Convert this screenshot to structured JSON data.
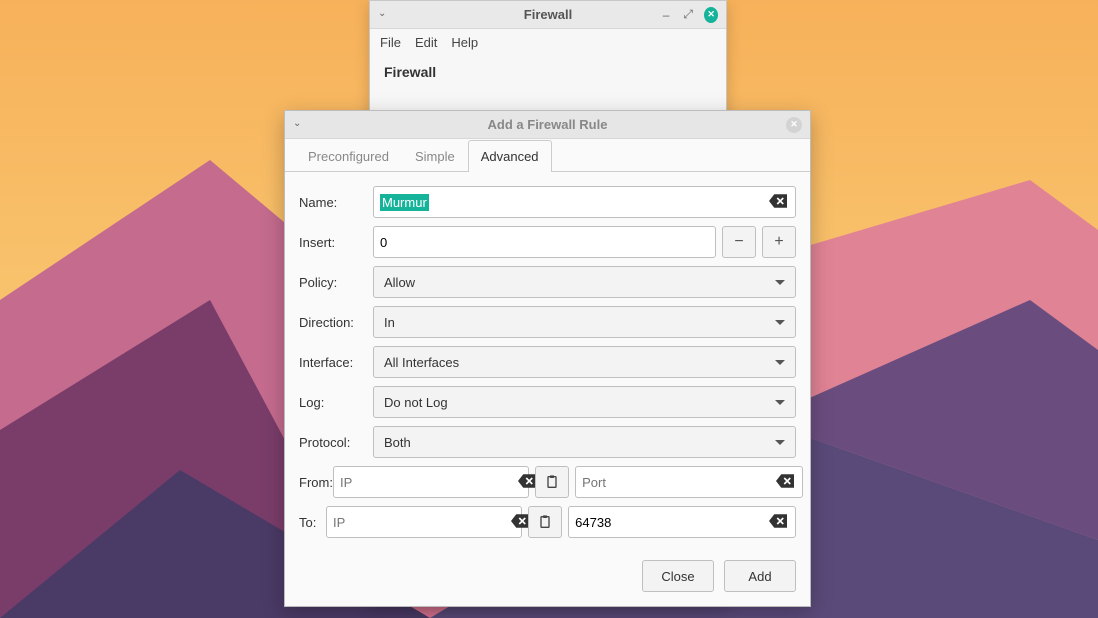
{
  "main_window": {
    "title": "Firewall",
    "menu": {
      "file": "File",
      "edit": "Edit",
      "help": "Help"
    },
    "section_title": "Firewall"
  },
  "dialog": {
    "title": "Add a Firewall Rule",
    "tabs": {
      "preconfigured": "Preconfigured",
      "simple": "Simple",
      "advanced": "Advanced"
    },
    "labels": {
      "name": "Name:",
      "insert": "Insert:",
      "policy": "Policy:",
      "direction": "Direction:",
      "interface": "Interface:",
      "log": "Log:",
      "protocol": "Protocol:",
      "from": "From:",
      "to": "To:"
    },
    "values": {
      "name": "Murmur",
      "insert": "0",
      "policy": "Allow",
      "direction": "In",
      "interface": "All Interfaces",
      "log": "Do not Log",
      "protocol": "Both",
      "from_ip": "",
      "from_port": "",
      "to_ip": "",
      "to_port": "64738"
    },
    "placeholders": {
      "ip": "IP",
      "port": "Port"
    },
    "buttons": {
      "close": "Close",
      "add": "Add"
    }
  }
}
